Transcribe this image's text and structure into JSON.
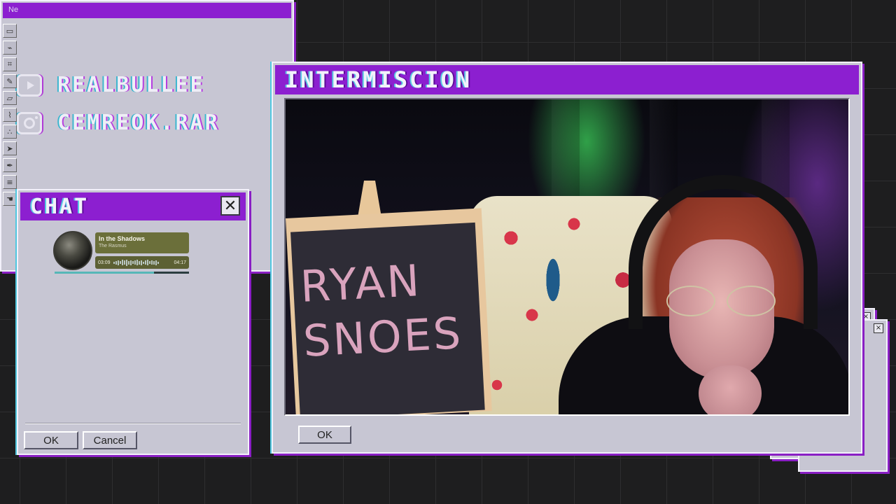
{
  "social": {
    "youtube_handle": "REALBULLEE",
    "instagram_handle": "CEMREOK.RAR"
  },
  "main_window": {
    "title": "INTERMISCION",
    "ok_label": "OK",
    "board_text_line1": "RYAN",
    "board_text_line2": "SNOES"
  },
  "chat_window": {
    "title": "CHAT",
    "close_symbol": "✕",
    "ok_label": "OK",
    "cancel_label": "Cancel"
  },
  "now_playing": {
    "track": "In the Shadows",
    "artist": "The Rasmus",
    "elapsed": "03:09",
    "duration": "04:17",
    "progress": 0.74
  },
  "paint_window": {
    "title": "Ne"
  },
  "icons": [
    "youtube-icon",
    "instagram-icon",
    "close-icon"
  ],
  "colors": {
    "accent_purple": "#8c1fd0",
    "window_gray": "#c7c6d3",
    "cyan_glitch": "#50c8e0"
  }
}
